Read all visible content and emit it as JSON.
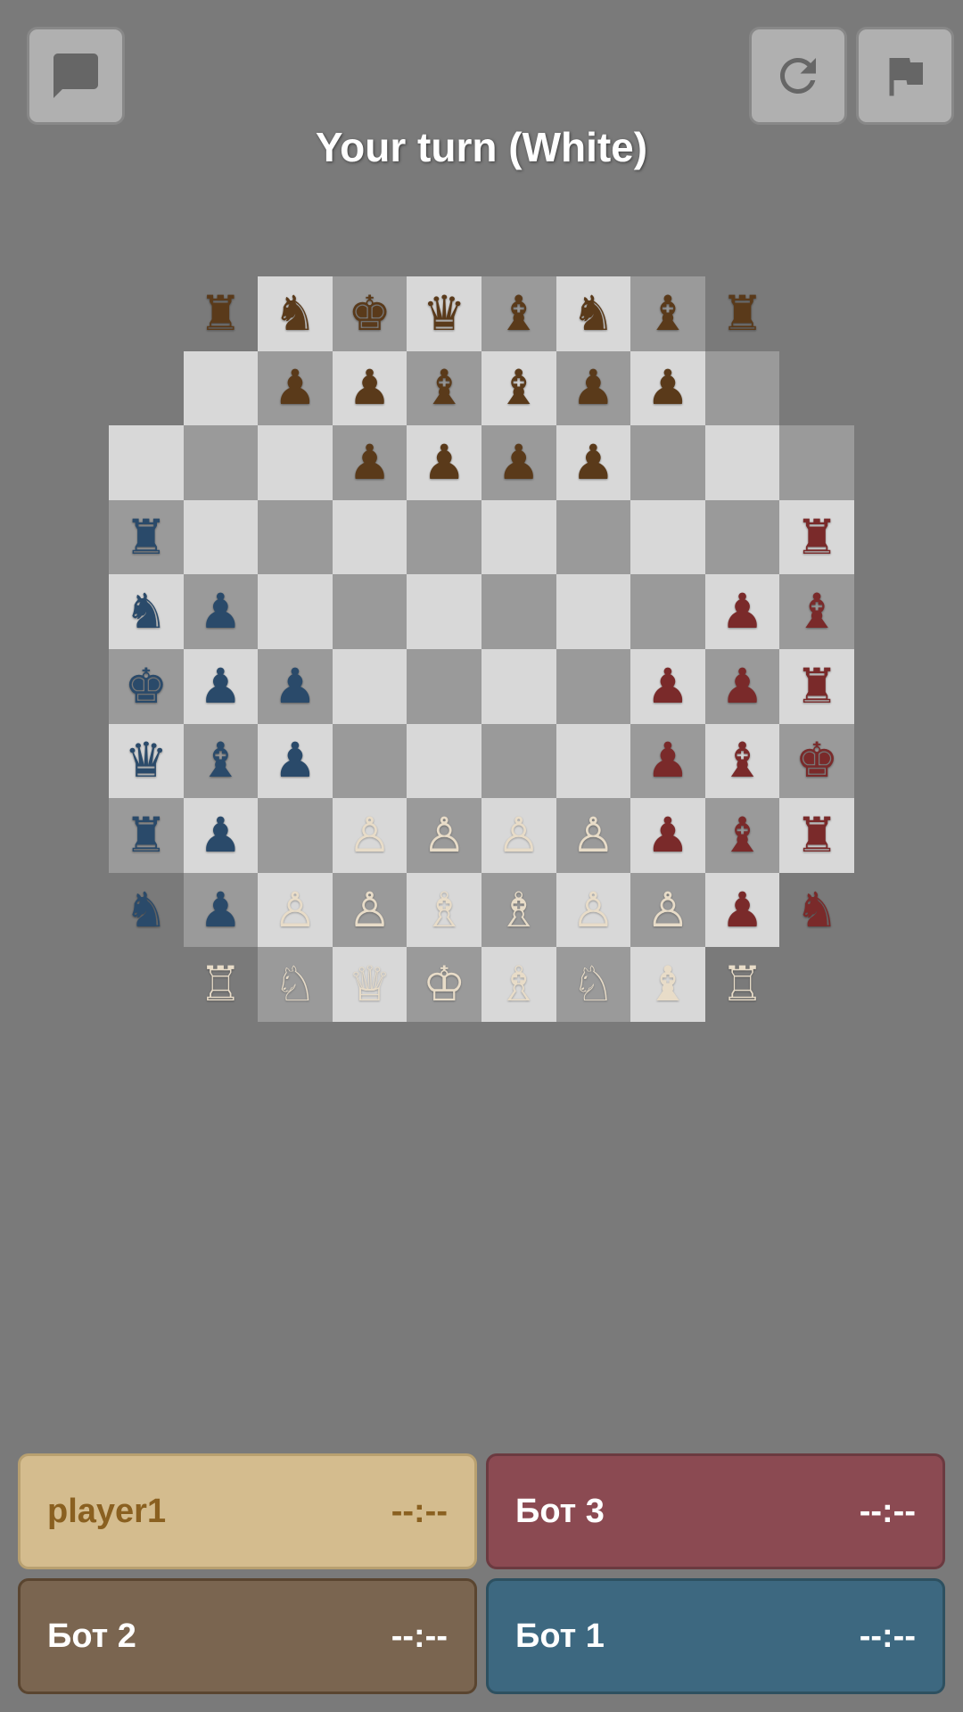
{
  "header": {
    "turn_text": "Your turn (White)",
    "chat_icon": "💬",
    "refresh_icon": "↻",
    "flag_icon": "⚑"
  },
  "players": {
    "player1": {
      "name": "player1",
      "time": "--:--",
      "color": "white"
    },
    "bot1": {
      "name": "Бот 1",
      "time": "--:--"
    },
    "bot2": {
      "name": "Бот 2",
      "time": "--:--"
    },
    "bot3": {
      "name": "Бот 3",
      "time": "--:--"
    }
  },
  "board": {
    "size": 10,
    "description": "4-player chess variant, 10x10 board"
  }
}
